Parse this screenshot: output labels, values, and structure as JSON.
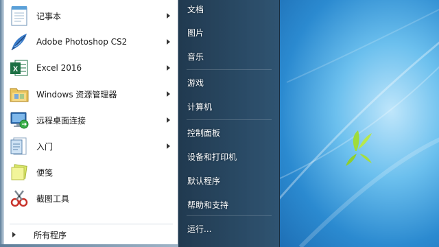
{
  "start_menu": {
    "pinned": [
      {
        "label": "记事本",
        "icon": "notepad-icon",
        "has_submenu": true
      },
      {
        "label": "Adobe Photoshop CS2",
        "icon": "photoshop-feather-icon",
        "has_submenu": true
      },
      {
        "label": "Excel 2016",
        "icon": "excel-icon",
        "has_submenu": true
      },
      {
        "label": "Windows 资源管理器",
        "icon": "folder-explorer-icon",
        "has_submenu": true
      },
      {
        "label": "远程桌面连接",
        "icon": "remote-desktop-icon",
        "has_submenu": true
      },
      {
        "label": "入门",
        "icon": "getting-started-icon",
        "has_submenu": true
      },
      {
        "label": "便笺",
        "icon": "sticky-notes-icon",
        "has_submenu": false
      },
      {
        "label": "截图工具",
        "icon": "scissors-icon",
        "has_submenu": false
      }
    ],
    "all_programs_label": "所有程序",
    "right_links": [
      {
        "label": "文档"
      },
      {
        "label": "图片"
      },
      {
        "label": "音乐"
      },
      {
        "label": "游戏"
      },
      {
        "label": "计算机"
      },
      {
        "label": "控制面板"
      },
      {
        "label": "设备和打印机"
      },
      {
        "label": "默认程序"
      },
      {
        "label": "帮助和支持"
      },
      {
        "label": "运行..."
      }
    ]
  },
  "colors": {
    "excel_green": "#1d7044",
    "right_pane": "#2a4560",
    "wallpaper": "#3a9ad9"
  }
}
